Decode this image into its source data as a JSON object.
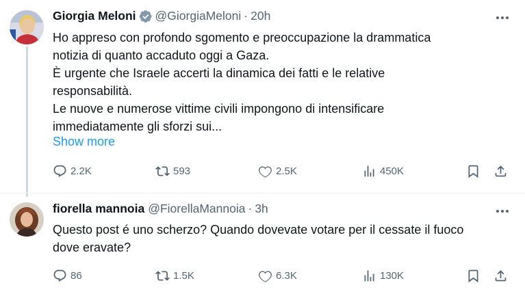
{
  "tweets": [
    {
      "author_name": "Giorgia Meloni",
      "handle": "@GiorgiaMeloni",
      "separator": "·",
      "time": "20h",
      "text_lines": [
        "Ho appreso con profondo sgomento e preoccupazione la drammatica",
        "notizia di quanto accaduto oggi a Gaza.",
        "È urgente che Israele accerti la dinamica dei fatti e le relative",
        "responsabilità.",
        "Le nuove e numerose vittime civili impongono di intensificare",
        "immediatamente gli sforzi sui..."
      ],
      "show_more": "Show more",
      "stats": {
        "replies": "2.2K",
        "reposts": "593",
        "likes": "2.5K",
        "views": "450K"
      },
      "verified_color": "#829aab"
    },
    {
      "author_name": "fiorella mannoia",
      "handle": "@FiorellaMannoia",
      "separator": "·",
      "time": "3h",
      "text_lines": [
        "Questo post é uno scherzo? Quando dovevate votare per il cessate il fuoco",
        "dove eravate?"
      ],
      "stats": {
        "replies": "86",
        "reposts": "1.5K",
        "likes": "6.3K",
        "views": "130K"
      }
    }
  ],
  "icons": {
    "reply": "reply-icon",
    "repost": "repost-icon",
    "like": "like-icon",
    "views": "views-icon",
    "bookmark": "bookmark-icon",
    "share": "share-icon",
    "more": "more-icon",
    "verified": "verified-badge-icon"
  },
  "colors": {
    "text": "#0f1419",
    "secondary": "#536471",
    "link": "#1d9bf0",
    "thread": "#cfd9de"
  }
}
